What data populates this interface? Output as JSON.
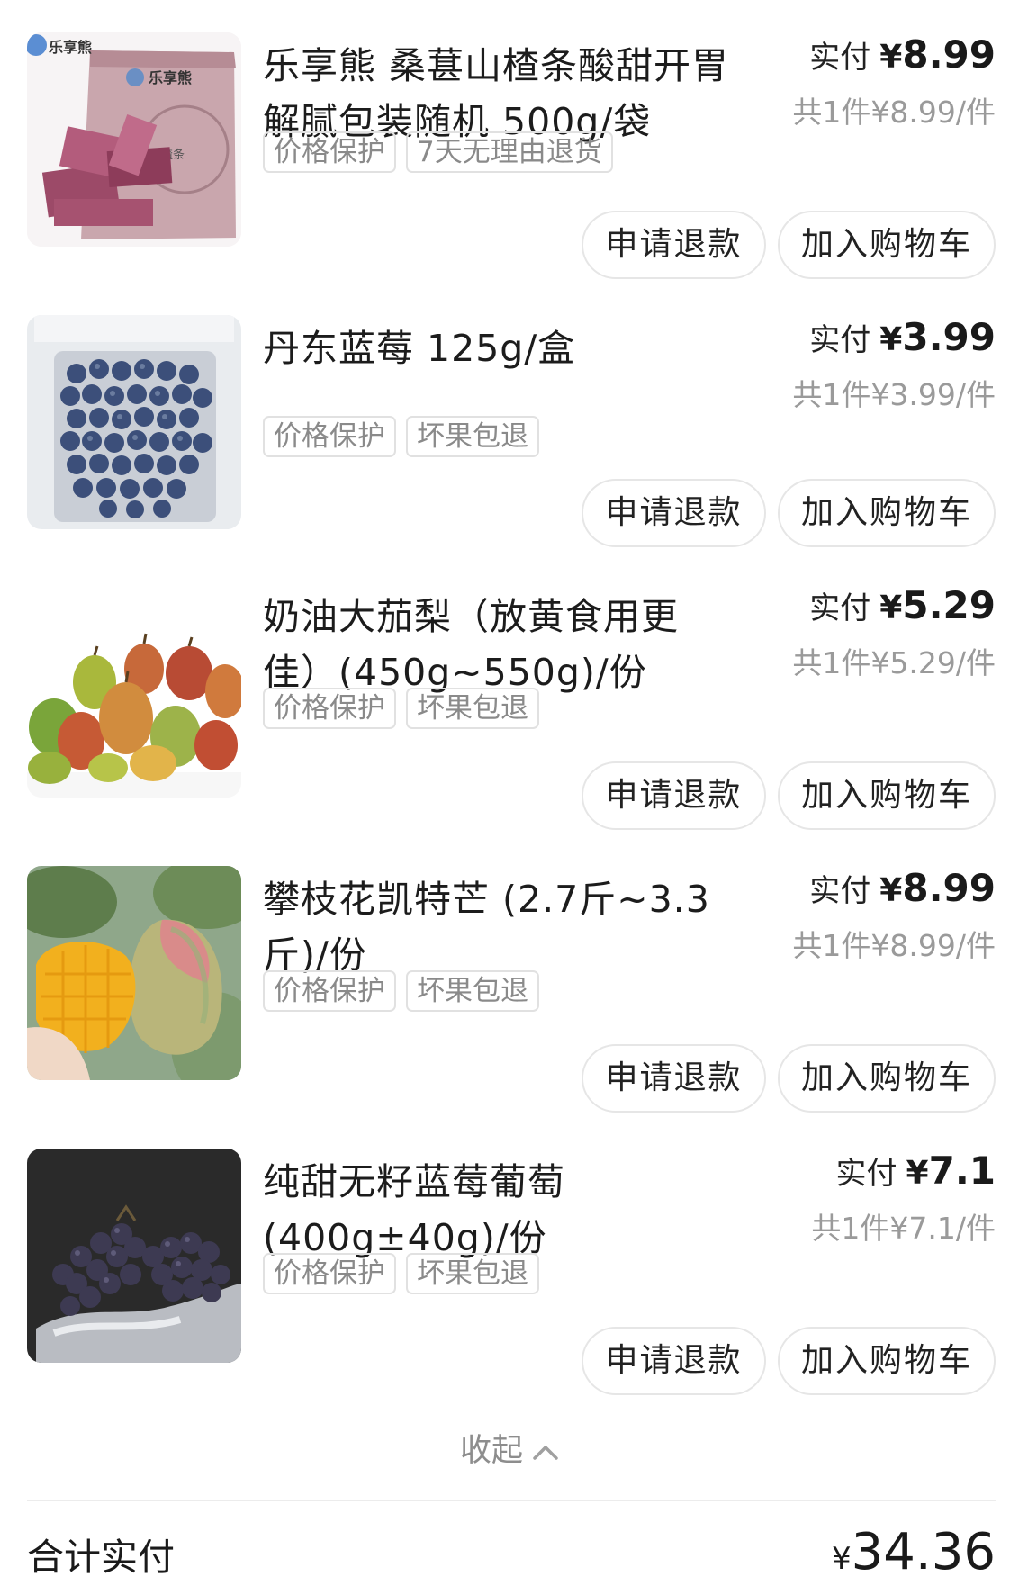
{
  "items": [
    {
      "title": "乐享熊 桑葚山楂条酸甜开胃解腻包装随机 500g/袋",
      "tags": [
        "价格保护",
        "7天无理由退货"
      ],
      "paid_label": "实付",
      "currency": "¥",
      "paid_amount": "8.99",
      "per_unit": "共1件¥8.99/件",
      "refund_label": "申请退款",
      "cart_label": "加入购物车",
      "image": "hawthorn-mulberry-strips-package",
      "image_text": "乐享熊",
      "image_text_2": "桑葚山楂条"
    },
    {
      "title": "丹东蓝莓 125g/盒",
      "tags": [
        "价格保护",
        "坏果包退"
      ],
      "paid_label": "实付",
      "currency": "¥",
      "paid_amount": "3.99",
      "per_unit": "共1件¥3.99/件",
      "refund_label": "申请退款",
      "cart_label": "加入购物车",
      "image": "blueberries-box"
    },
    {
      "title": "奶油大茄梨（放黄食用更佳）(450g~550g)/份",
      "tags": [
        "价格保护",
        "坏果包退"
      ],
      "paid_label": "实付",
      "currency": "¥",
      "paid_amount": "5.29",
      "per_unit": "共1件¥5.29/件",
      "refund_label": "申请退款",
      "cart_label": "加入购物车",
      "image": "pears-pile"
    },
    {
      "title": "攀枝花凯特芒 (2.7斤~3.3斤)/份",
      "tags": [
        "价格保护",
        "坏果包退"
      ],
      "paid_label": "实付",
      "currency": "¥",
      "paid_amount": "8.99",
      "per_unit": "共1件¥8.99/件",
      "refund_label": "申请退款",
      "cart_label": "加入购物车",
      "image": "mango-cut"
    },
    {
      "title": "纯甜无籽蓝莓葡萄 (400g±40g)/份",
      "tags": [
        "价格保护",
        "坏果包退"
      ],
      "paid_label": "实付",
      "currency": "¥",
      "paid_amount": "7.1",
      "per_unit": "共1件¥7.1/件",
      "refund_label": "申请退款",
      "cart_label": "加入购物车",
      "image": "blueberry-grapes"
    }
  ],
  "collapse_label": "收起",
  "total": {
    "label": "合计实付",
    "currency": "¥",
    "amount": "34.36"
  }
}
